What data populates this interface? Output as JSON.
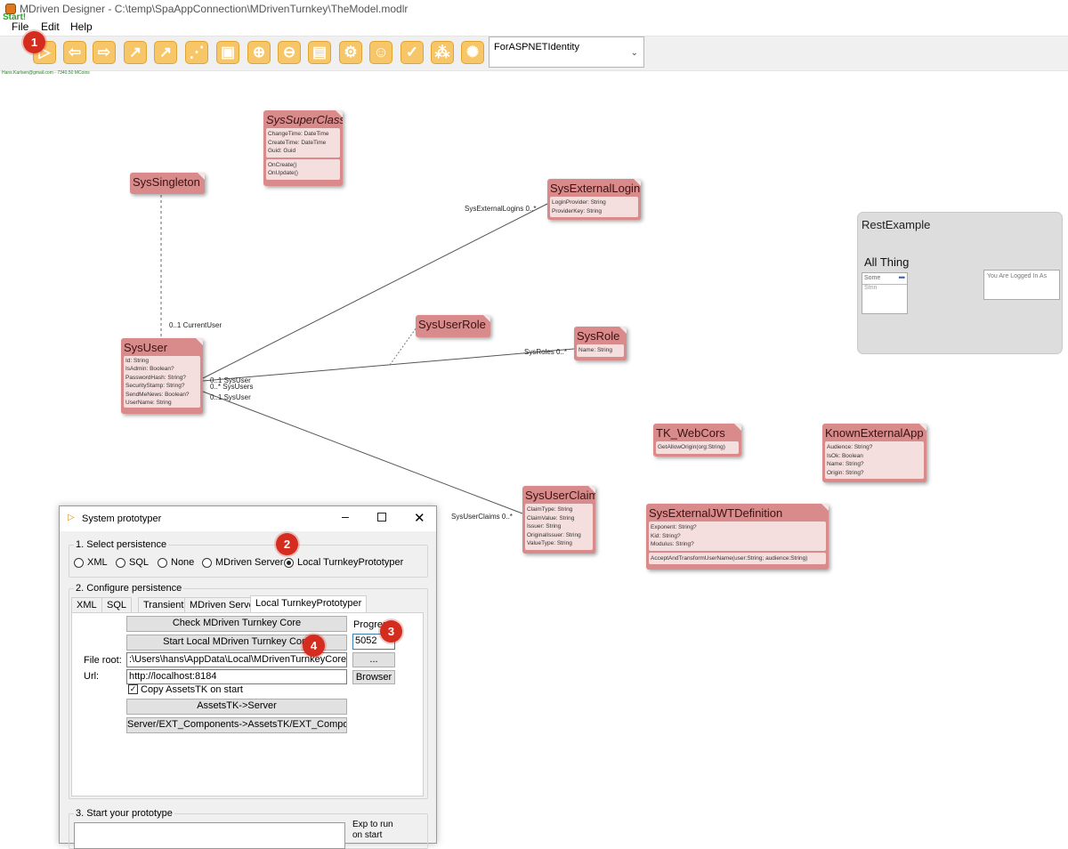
{
  "window": {
    "title": "MDriven Designer - C:\\temp\\SpaAppConnection\\MDrivenTurnkey\\TheModel.modlr"
  },
  "menu": {
    "items": [
      "File",
      "Edit",
      "Help"
    ]
  },
  "toolbar": {
    "start_label": "Start!",
    "model_selector": "ForASPNETIdentity",
    "buttons": [
      "play-icon",
      "back-arrow-icon",
      "forward-arrow-icon",
      "association-arrow-icon",
      "inheritance-arrow-icon",
      "dashed-line-icon",
      "select-window-icon",
      "zoom-in-icon",
      "zoom-out-icon",
      "form-icon",
      "settings-gears-icon",
      "users-icon",
      "check-icon",
      "tree-icon",
      "cog-sun-icon"
    ]
  },
  "user_line": "Hans.Karlsen@gmail.com - 7340.50 MCoins",
  "badges": {
    "b1": "1",
    "b2": "2",
    "b3": "3",
    "b4": "4"
  },
  "classes": {
    "sys_super_class": {
      "name": "SysSuperClass",
      "attributes": [
        "ChangeTime: DateTime",
        "CreateTime: DateTime",
        "Guid: Guid"
      ],
      "operations": [
        "OnCreate()",
        "OnUpdate()"
      ]
    },
    "sys_singleton": {
      "name": "SysSingleton"
    },
    "sys_user": {
      "name": "SysUser",
      "attributes": [
        "Id: String",
        "IsAdmin: Boolean?",
        "PasswordHash: String?",
        "SecurityStamp: String?",
        "SendMeNews: Boolean?",
        "UserName: String"
      ]
    },
    "sys_external_login": {
      "name": "SysExternalLogin",
      "attributes": [
        "LoginProvider: String",
        "ProviderKey: String"
      ]
    },
    "sys_user_role": {
      "name": "SysUserRole"
    },
    "sys_role": {
      "name": "SysRole",
      "attributes": [
        "Name: String"
      ]
    },
    "tk_web_cors": {
      "name": "TK_WebCors",
      "attributes": [
        "GetAllowOrigin(org:String)"
      ]
    },
    "known_external_app": {
      "name": "KnownExternalApp",
      "attributes": [
        "Audience: String?",
        "IsOk: Boolean",
        "Name: String?",
        "Origin: String?"
      ]
    },
    "sys_user_claim": {
      "name": "SysUserClaim",
      "attributes": [
        "ClaimType: String",
        "ClaimValue: String",
        "Issuer: String",
        "OriginalIssuer: String",
        "ValueType: String"
      ]
    },
    "sys_external_jwt_definition": {
      "name": "SysExternalJWTDefinition",
      "attributes": [
        "Exponent: String?",
        "Kid: String?",
        "Modulus: String?"
      ],
      "operations": [
        "AcceptAndTransformUserName(user:String; audience:String)"
      ]
    }
  },
  "association_labels": {
    "current_user": "0..1 CurrentUser",
    "sys_external_logins": "SysExternalLogins 0..*",
    "sys_roles": "SysRoles 0..*",
    "sys_user_a": "0..1 SysUser",
    "sys_users": "0..* SysUsers",
    "sys_user_b": "0..1 SysUser",
    "sys_user_claims": "SysUserClaims 0..*"
  },
  "rest_example": {
    "title": "RestExample",
    "heading": "All Thing",
    "list_text": "Some",
    "list_text2": "Strin",
    "logged_in_text": "You Are Logged In As"
  },
  "dialog": {
    "title": "System prototyper",
    "section1": "1. Select persistence",
    "persistence_options": [
      "XML",
      "SQL",
      "None",
      "MDriven Server",
      "Local TurnkeyPrototyper"
    ],
    "selected_persistence": "Local TurnkeyPrototyper",
    "section2": "2. Configure persistence",
    "tabs": [
      "XML",
      "SQL",
      "Transient",
      "MDriven Server",
      "Local TurnkeyPrototyper"
    ],
    "check_button": "Check MDriven Turnkey Core",
    "start_button": "Start Local MDriven Turnkey Core",
    "progress_label": "Progress",
    "progress_value": "5052",
    "file_root_label": "File root:",
    "file_root_value": ":\\Users\\hans\\AppData\\Local\\MDrivenTurnkeyCoreLocal\\",
    "browse_dots": "...",
    "url_label": "Url:",
    "url_value": "http://localhost:8184",
    "browser_button": "Browser",
    "copy_assets_label": "Copy AssetsTK on start",
    "assets_button": "AssetsTK->Server",
    "ext_components_button": "Server/EXT_Components->AssetsTK/EXT_Components",
    "section3": "3. Start your prototype",
    "exp_text1": "Exp to run",
    "exp_text2": "on start"
  }
}
